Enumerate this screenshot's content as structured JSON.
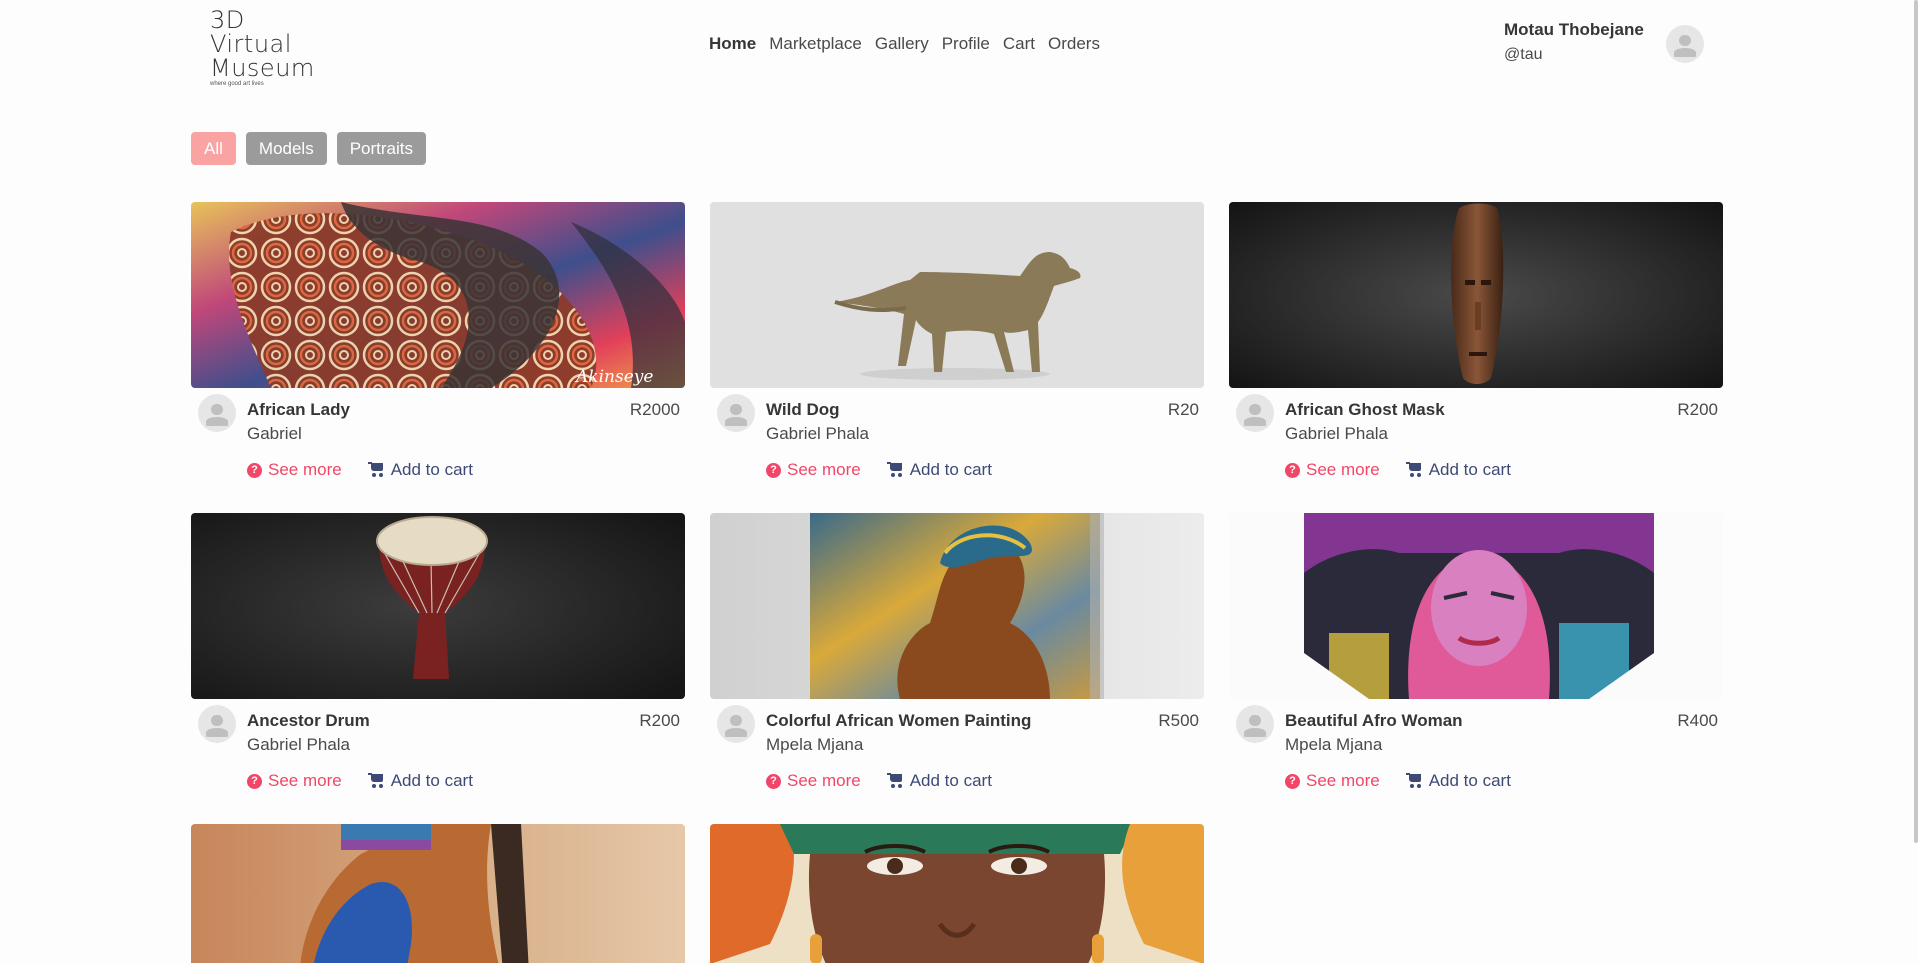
{
  "brand": {
    "line1": "3D",
    "line2": "Virtual",
    "line3": "Museum",
    "tagline": "where good art lives"
  },
  "nav": [
    {
      "label": "Home",
      "active": true
    },
    {
      "label": "Marketplace"
    },
    {
      "label": "Gallery"
    },
    {
      "label": "Profile"
    },
    {
      "label": "Cart"
    },
    {
      "label": "Orders"
    }
  ],
  "user": {
    "name": "Motau Thobejane",
    "handle": "@tau"
  },
  "filters": [
    {
      "label": "All",
      "active": true
    },
    {
      "label": "Models"
    },
    {
      "label": "Portraits"
    }
  ],
  "actions": {
    "see_more": "See more",
    "add_to_cart": "Add to cart"
  },
  "items": [
    {
      "title": "African Lady",
      "price": "R2000",
      "author": "Gabriel",
      "signature": "Akinseye"
    },
    {
      "title": "Wild Dog",
      "price": "R20",
      "author": "Gabriel Phala"
    },
    {
      "title": "African Ghost Mask",
      "price": "R200",
      "author": "Gabriel Phala"
    },
    {
      "title": "Ancestor Drum",
      "price": "R200",
      "author": "Gabriel Phala"
    },
    {
      "title": "Colorful African Women Painting",
      "price": "R500",
      "author": "Mpela Mjana"
    },
    {
      "title": "Beautiful Afro Woman",
      "price": "R400",
      "author": "Mpela Mjana"
    },
    {
      "title": "",
      "price": "",
      "author": ""
    },
    {
      "title": "",
      "price": "",
      "author": ""
    }
  ],
  "colors": {
    "accent_red": "#f14668",
    "filter_active": "#f9a3a3",
    "filter_inactive": "#9b9b9b",
    "cart_blue": "#3e4a75"
  }
}
